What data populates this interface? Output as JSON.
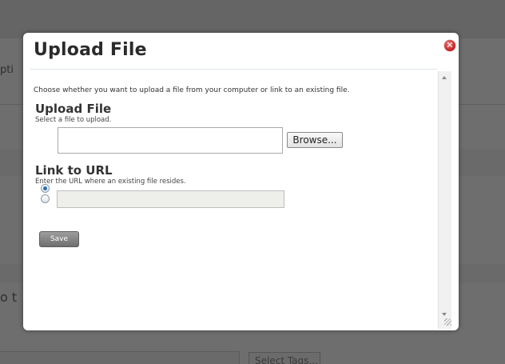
{
  "background": {
    "fragment_left": "pti",
    "fragment_lower": "o t",
    "tags_button_label": "Select Tags..."
  },
  "modal": {
    "title": "Upload File",
    "close_icon": "close-icon",
    "intro_text": "Choose whether you want to upload a file from your computer or link to an existing file.",
    "upload_section": {
      "title": "Upload File",
      "subtitle": "Select a file to upload.",
      "radio_checked": true,
      "file_value": "",
      "browse_label": "Browse..."
    },
    "url_section": {
      "title": "Link to URL",
      "subtitle": "Enter the URL where an existing file resides.",
      "radio_checked": false,
      "url_value": ""
    },
    "save_label": "Save"
  },
  "colors": {
    "overlay": "#6e6e6e",
    "close_red": "#c21f1f",
    "radio_selected": "#2a6fb3",
    "save_button": "#7f7f7f"
  }
}
